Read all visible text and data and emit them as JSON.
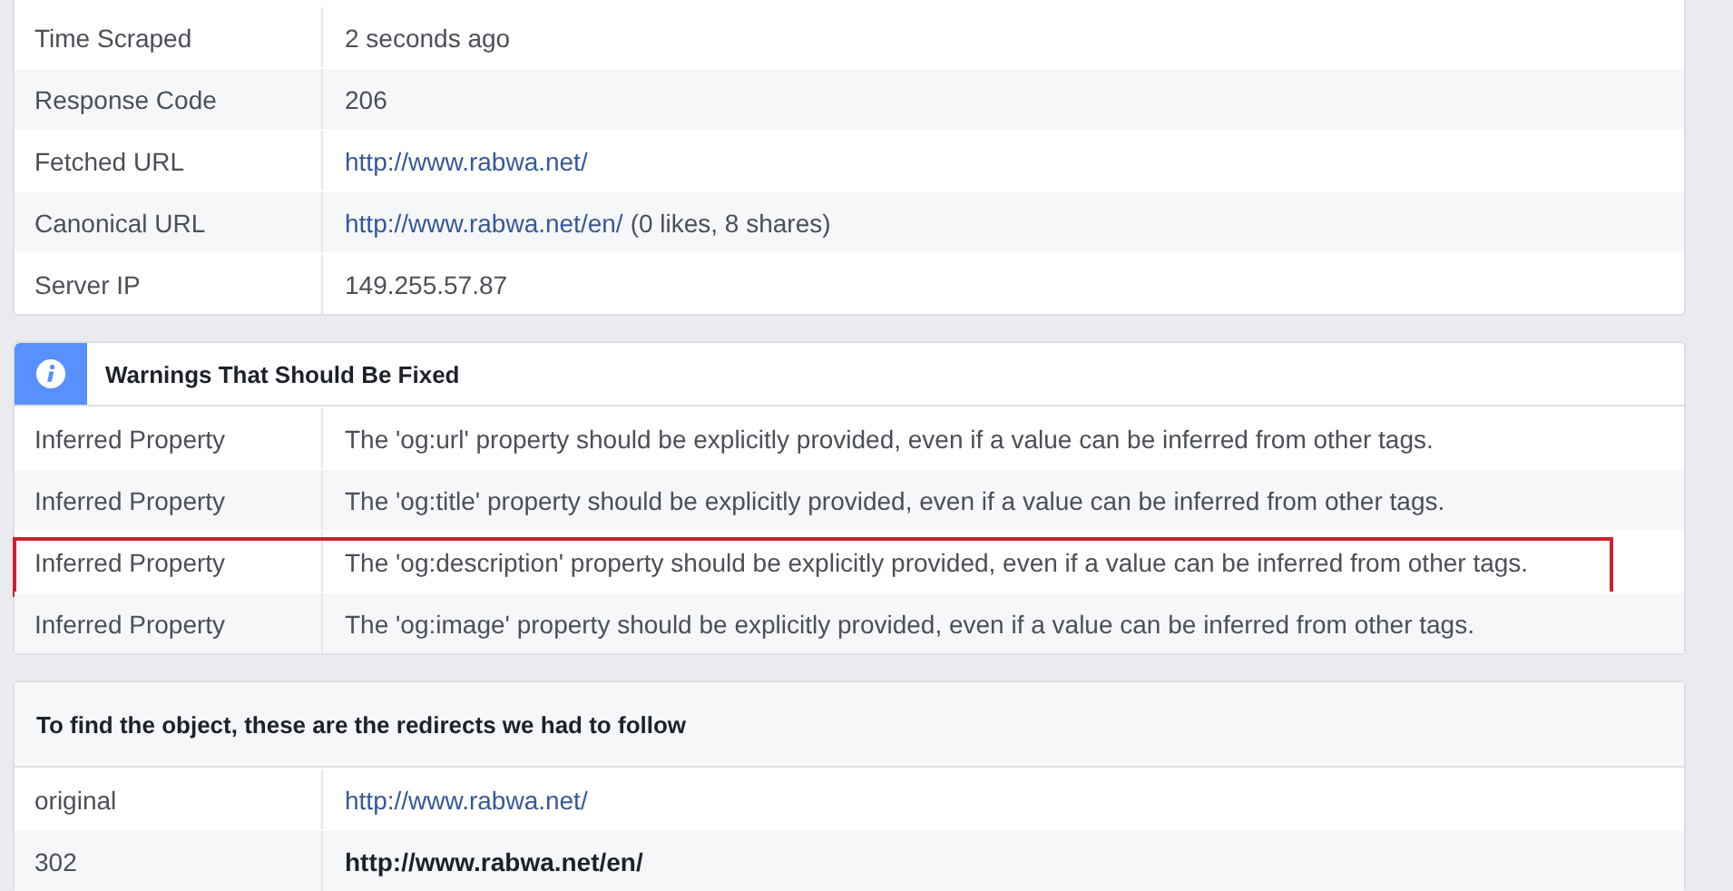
{
  "properties": [
    {
      "label": "Time Scraped",
      "value": "2 seconds ago",
      "link": false
    },
    {
      "label": "Response Code",
      "value": "206",
      "link": false
    },
    {
      "label": "Fetched URL",
      "value": "http://www.rabwa.net/",
      "link": true
    },
    {
      "label": "Canonical URL",
      "value": "http://www.rabwa.net/en/",
      "link": true,
      "note": "(0 likes, 8 shares)"
    },
    {
      "label": "Server IP",
      "value": "149.255.57.87",
      "link": false
    }
  ],
  "warnings": {
    "title": "Warnings That Should Be Fixed",
    "rows": [
      {
        "label": "Inferred Property",
        "message": "The 'og:url' property should be explicitly provided, even if a value can be inferred from other tags.",
        "highlighted": false
      },
      {
        "label": "Inferred Property",
        "message": "The 'og:title' property should be explicitly provided, even if a value can be inferred from other tags.",
        "highlighted": false
      },
      {
        "label": "Inferred Property",
        "message": "The 'og:description' property should be explicitly provided, even if a value can be inferred from other tags.",
        "highlighted": true
      },
      {
        "label": "Inferred Property",
        "message": "The 'og:image' property should be explicitly provided, even if a value can be inferred from other tags.",
        "highlighted": false
      }
    ]
  },
  "redirects": {
    "title": "To find the object, these are the redirects we had to follow",
    "rows": [
      {
        "label": "original",
        "value": "http://www.rabwa.net/",
        "bold": false
      },
      {
        "label": "302",
        "value": "http://www.rabwa.net/en/",
        "bold": true
      }
    ]
  }
}
